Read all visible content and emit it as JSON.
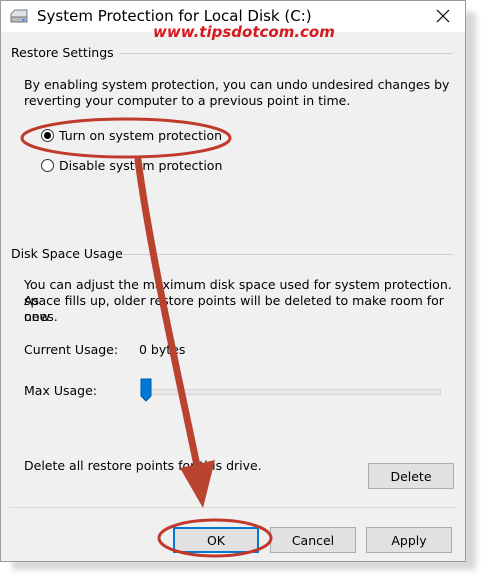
{
  "window": {
    "title": "System Protection for Local Disk (C:)",
    "icon": "drive-icon"
  },
  "watermark": "www.tipsdotcom.com",
  "restore_settings": {
    "heading": "Restore Settings",
    "description_line1": "By enabling system protection, you can undo undesired changes by",
    "description_line2": "reverting your computer to a previous point in time.",
    "options": [
      {
        "label": "Turn on system protection",
        "selected": true
      },
      {
        "label": "Disable system protection",
        "selected": false
      }
    ]
  },
  "disk_space": {
    "heading": "Disk Space Usage",
    "description_line1": "You can adjust the maximum disk space used for system protection. As",
    "description_line2": "space fills up, older restore points will be deleted to make room for new",
    "description_line3": "ones.",
    "current_usage_label": "Current Usage:",
    "current_usage_value": "0 bytes",
    "max_usage_label": "Max Usage:",
    "max_usage_fraction": 0.0,
    "delete_text": "Delete all restore points for this drive.",
    "delete_button": "Delete"
  },
  "buttons": {
    "ok": "OK",
    "cancel": "Cancel",
    "apply": "Apply"
  },
  "colors": {
    "annotation": "#c0392b",
    "accent": "#0078d7",
    "watermark": "#d71920"
  }
}
